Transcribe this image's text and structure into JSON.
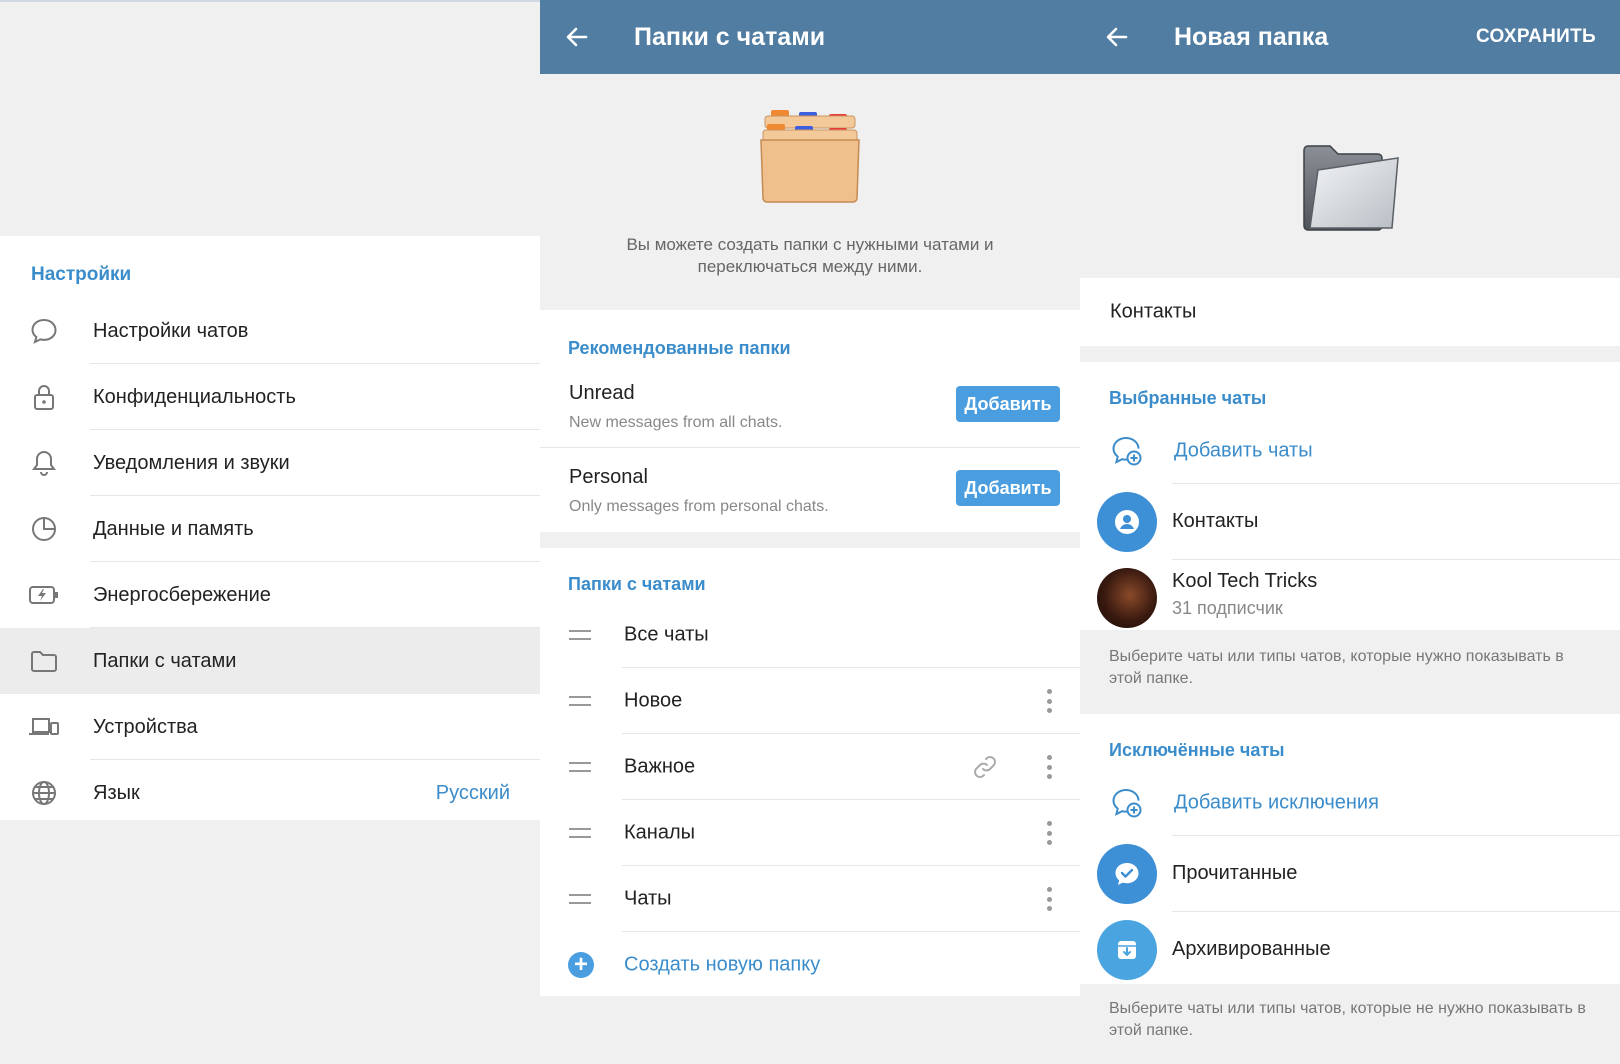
{
  "settings_panel": {
    "section_title": "Настройки",
    "items": [
      {
        "label": "Настройки чатов",
        "icon": "chat-bubble-icon"
      },
      {
        "label": "Конфиденциальность",
        "icon": "lock-icon"
      },
      {
        "label": "Уведомления и звуки",
        "icon": "bell-icon"
      },
      {
        "label": "Данные и память",
        "icon": "pie-chart-icon"
      },
      {
        "label": "Энергосбережение",
        "icon": "battery-bolt-icon"
      },
      {
        "label": "Папки с чатами",
        "icon": "folder-icon"
      },
      {
        "label": "Устройства",
        "icon": "devices-icon"
      },
      {
        "label": "Язык",
        "icon": "globe-icon",
        "value": "Русский"
      }
    ]
  },
  "folders_panel": {
    "title": "Папки с чатами",
    "description": "Вы можете создать папки с нужными чатами и переключаться между ними.",
    "recommended": {
      "title": "Рекомендованные папки",
      "items": [
        {
          "title": "Unread",
          "subtitle": "New messages from all chats.",
          "button": "Добавить"
        },
        {
          "title": "Personal",
          "subtitle": "Only messages from personal chats.",
          "button": "Добавить"
        }
      ]
    },
    "folders": {
      "title": "Папки с чатами",
      "items": [
        {
          "label": "Все чаты"
        },
        {
          "label": "Новое"
        },
        {
          "label": "Важное"
        },
        {
          "label": "Каналы"
        },
        {
          "label": "Чаты"
        }
      ],
      "create_label": "Создать новую папку"
    }
  },
  "new_folder_panel": {
    "title": "Новая папка",
    "save": "СОХРАНИТЬ",
    "folder_name": "Контакты",
    "included": {
      "title": "Выбранные чаты",
      "add_label": "Добавить чаты",
      "items": [
        {
          "label": "Контакты",
          "color": "#3d8fd6"
        },
        {
          "label": "Kool Tech Tricks",
          "subtitle": "31 подписчик"
        }
      ],
      "hint": "Выберите чаты или типы чатов, которые нужно показывать в этой папке."
    },
    "excluded": {
      "title": "Исключённые чаты",
      "add_label": "Добавить исключения",
      "items": [
        {
          "label": "Прочитанные",
          "color": "#3d8fd6"
        },
        {
          "label": "Архивированные",
          "color": "#4aa4e0"
        }
      ],
      "hint": "Выберите чаты или типы чатов, которые не нужно показывать в этой папке."
    }
  },
  "colors": {
    "header": "#517da2",
    "accent": "#3a8ccb",
    "button": "#4a9ee0"
  }
}
